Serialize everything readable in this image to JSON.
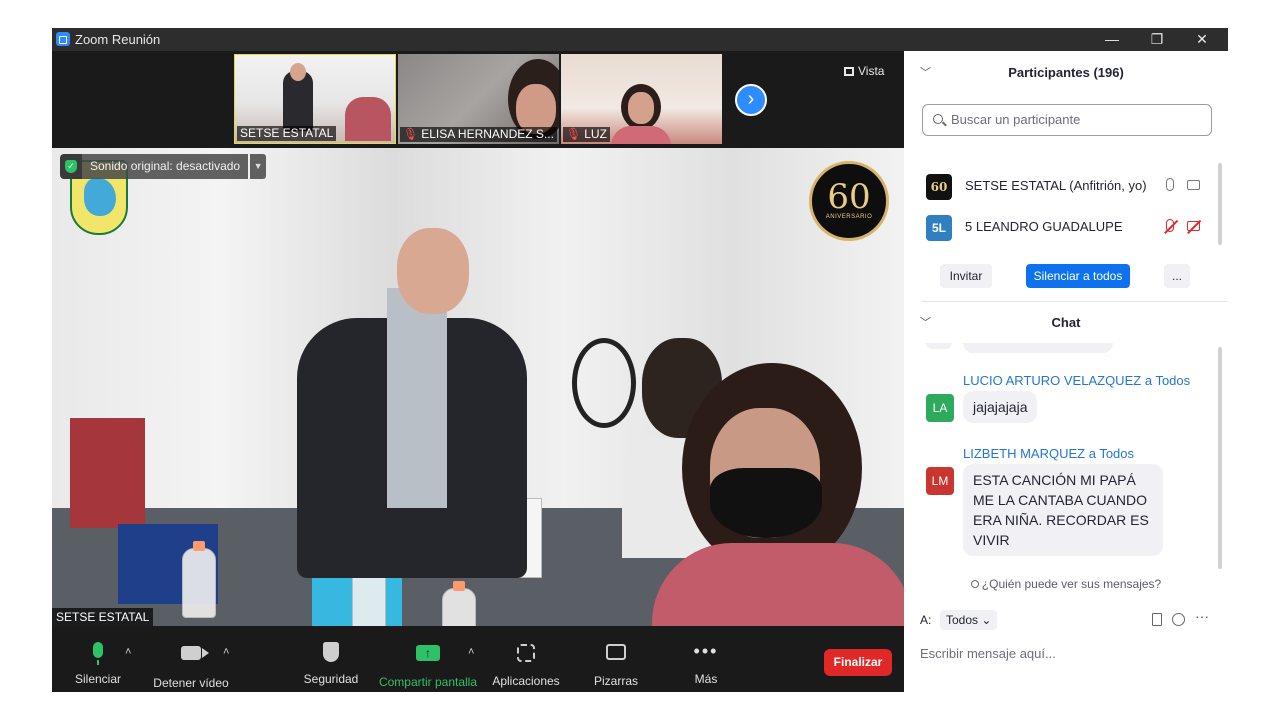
{
  "window": {
    "title": "Zoom Reunión",
    "minimize": "—",
    "restore": "❐",
    "close": "✕"
  },
  "video": {
    "view_label": "Vista",
    "thumbnails": [
      {
        "name": "SETSE ESTATAL",
        "muted": false
      },
      {
        "name": "ELISA HERNANDEZ S...",
        "muted": true
      },
      {
        "name": "LUZ",
        "muted": true
      }
    ],
    "next_arrow": "›",
    "main_label": "SETSE ESTATAL",
    "sound_status": "Sonido original: desactivado",
    "badge_text": "60",
    "badge_sub": "ANIVERSARIO"
  },
  "toolbar": {
    "mute": "Silenciar",
    "stop_video": "Detener vídeo",
    "security": "Seguridad",
    "share_screen": "Compartir pantalla",
    "apps": "Aplicaciones",
    "whiteboards": "Pizarras",
    "more": "Más",
    "end": "Finalizar"
  },
  "participants": {
    "title": "Participantes (196)",
    "search_placeholder": "Buscar un participante",
    "list": [
      {
        "avatar": "60",
        "name": "SETSE ESTATAL (Anfitrión, yo)",
        "muted": false
      },
      {
        "avatar": "5L",
        "name": "5 LEANDRO GUADALUPE",
        "muted": true
      }
    ],
    "invite": "Invitar",
    "mute_all": "Silenciar a todos",
    "more": "..."
  },
  "chat": {
    "title": "Chat",
    "messages": [
      {
        "avatar": "LA",
        "sender": "LUCIO ARTURO VELAZQUEZ",
        "to": "Todos",
        "text": "jajajajaja",
        "color": "#2eaa5c"
      },
      {
        "avatar": "LM",
        "sender": "LIZBETH MARQUEZ",
        "to": "Todos",
        "text": "ESTA CANCIÓN MI PAPÁ ME LA CANTABA CUANDO ERA NIÑA. RECORDAR ES VIVIR",
        "color": "#c8362f"
      }
    ],
    "to_word": "a",
    "who_can_see": "¿Quién puede ver sus mensajes?",
    "to_label": "A:",
    "to_value": "Todos",
    "more": "···",
    "input_placeholder": "Escribir mensaje aquí..."
  },
  "colors": {
    "zoom_blue": "#2d8cff",
    "end_red": "#e02828",
    "active_green": "#2ec266"
  }
}
